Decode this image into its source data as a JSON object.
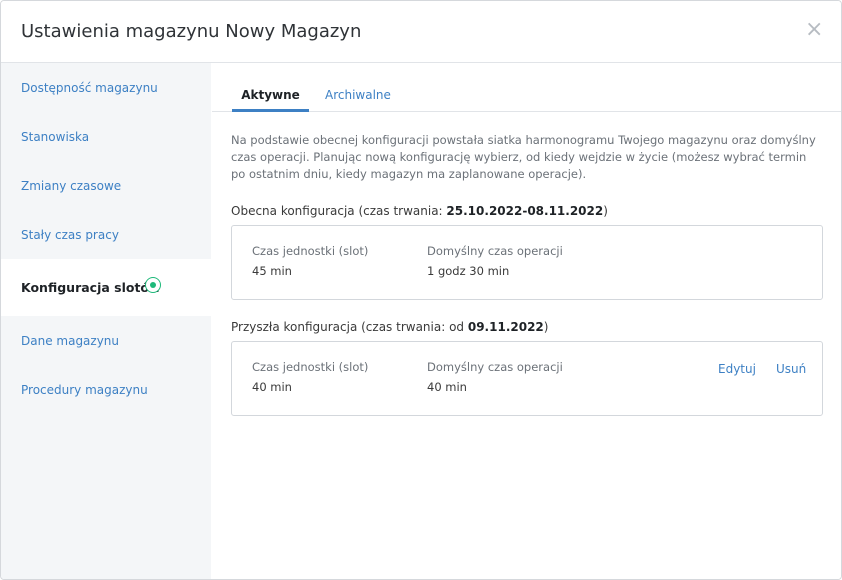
{
  "modal": {
    "title": "Ustawienia magazynu Nowy Magazyn",
    "close_glyph": "×"
  },
  "sidebar": {
    "items": [
      {
        "label": "Dostępność magazynu"
      },
      {
        "label": "Stanowiska"
      },
      {
        "label": "Zmiany czasowe"
      },
      {
        "label": "Stały czas pracy"
      },
      {
        "label": "Konfiguracja slotów",
        "active": true
      },
      {
        "label": "Dane magazynu"
      },
      {
        "label": "Procedury magazynu"
      }
    ]
  },
  "tabs": [
    {
      "label": "Aktywne",
      "active": true
    },
    {
      "label": "Archiwalne",
      "active": false
    }
  ],
  "intro_text": "Na podstawie obecnej konfiguracji powstała siatka harmonogramu Twojego magazynu oraz domyślny czas operacji. Planując nową konfigurację wybierz, od kiedy wejdzie w życie (możesz wybrać termin po ostatnim dniu, kiedy magazyn ma zaplanowane operacje).",
  "current_config": {
    "title_prefix": "Obecna konfiguracja (czas trwania: ",
    "date_range": "25.10.2022-08.11.2022",
    "title_suffix": ")",
    "slot_label": "Czas jednostki (slot)",
    "slot_value": "45 min",
    "default_time_label": "Domyślny czas operacji",
    "default_time_value": "1 godz 30 min"
  },
  "future_config": {
    "title_prefix": "Przyszła konfiguracja (czas trwania: od ",
    "date_from": "09.11.2022",
    "title_suffix": ")",
    "slot_label": "Czas jednostki (slot)",
    "slot_value": "40 min",
    "default_time_label": "Domyślny czas operacji",
    "default_time_value": "40 min",
    "edit_label": "Edytuj",
    "delete_label": "Usuń"
  },
  "colors": {
    "accent": "#3d80c4",
    "active_dot": "#1eb97a",
    "sidebar_bg": "#f4f6f8"
  }
}
